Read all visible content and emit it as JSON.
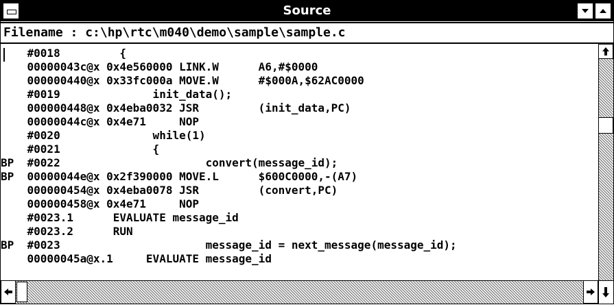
{
  "window": {
    "title": "Source"
  },
  "filename": {
    "text": "Filename : c:\\hp\\rtc\\m040\\demo\\sample\\sample.c"
  },
  "icons": {
    "system_menu": "system-menu-icon",
    "minimize": "minimize-arrow-icon",
    "maximize": "maximize-arrow-icon",
    "scroll_up": "scroll-up-arrow-icon",
    "scroll_left": "scroll-left-arrow-icon",
    "scroll_right": "scroll-right-arrow-icon",
    "scroll_down": "scroll-down-arrow-icon"
  },
  "source_lines": [
    "    #0018         {",
    "    00000043c@x 0x4e560000 LINK.W      A6,#$0000",
    "    000000440@x 0x33fc000a MOVE.W      #$000A,$62AC0000",
    "    #0019              init_data();",
    "    000000448@x 0x4eba0032 JSR         (init_data,PC)",
    "    00000044c@x 0x4e71     NOP",
    "    #0020              while(1)",
    "    #0021              {",
    "BP  #0022                      convert(message_id);",
    "BP  00000044e@x 0x2f390000 MOVE.L      $600C0000,-(A7)",
    "    000000454@x 0x4eba0078 JSR         (convert,PC)",
    "    000000458@x 0x4e71     NOP",
    "    #0023.1      EVALUATE message_id",
    "    #0023.2      RUN",
    "BP  #0023                      message_id = next_message(message_id);",
    "    00000045a@x.1     EVALUATE message_id"
  ]
}
